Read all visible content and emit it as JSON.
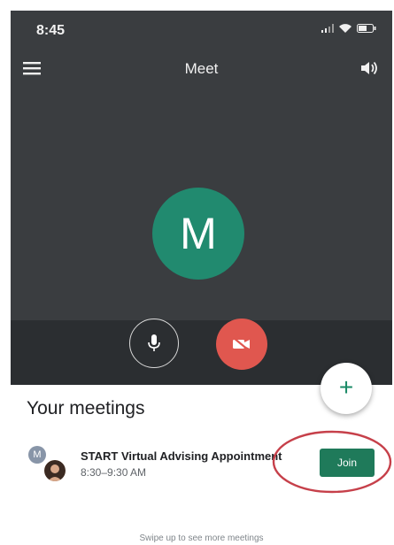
{
  "status_bar": {
    "time": "8:45"
  },
  "header": {
    "title": "Meet"
  },
  "call": {
    "avatar_letter": "M"
  },
  "meetings": {
    "heading": "Your meetings",
    "items": [
      {
        "avatar_letter": "M",
        "title": "START Virtual Advising Appointment",
        "time": "8:30–9:30 AM",
        "join_label": "Join"
      }
    ],
    "swipe_hint": "Swipe up to see more meetings"
  },
  "fab": {
    "label": "+"
  },
  "colors": {
    "accent": "#1f7a5a",
    "avatar": "#218a6f",
    "end_video": "#e0574f",
    "annotation": "#c6404a"
  }
}
